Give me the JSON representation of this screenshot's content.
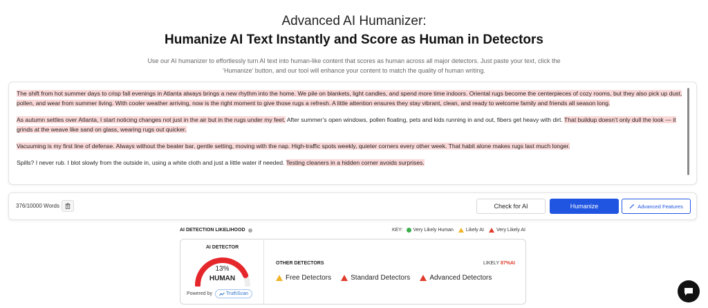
{
  "header": {
    "title_line1": "Advanced AI Humanizer:",
    "title_line2": "Humanize AI Text Instantly and Score as Human in Detectors",
    "subtitle": "Use our AI humanizer to effortlessly turn AI text into human-like content that scores as human across all major detectors. Just paste your text, click the ‘Humanize’ button, and our tool will enhance your content to match the quality of human writing."
  },
  "editor": {
    "paragraphs": [
      {
        "segments": [
          {
            "text": "The shift from hot summer days to crisp fall evenings in Atlanta always brings a new rhythm into the home. We pile on blankets, light candles, and spend more time indoors. Oriental rugs become the centerpieces of cozy rooms, but they also pick up dust, pollen, and wear from summer living. With cooler weather arriving, now is the right moment to give those rugs a refresh. A little attention ensures they stay vibrant, clean, and ready to welcome family and friends all season long.",
            "highlight": true
          }
        ]
      },
      {
        "segments": [
          {
            "text": "As autumn settles over Atlanta, I start noticing changes not just in the air but in the rugs under my feet.",
            "highlight": true
          },
          {
            "text": " After summer’s open windows, pollen floating, pets and kids running in and out, fibers get heavy with dirt. ",
            "highlight": false
          },
          {
            "text": "That buildup doesn’t only dull the look — it grinds at the weave like sand on glass, wearing rugs out quicker.",
            "highlight": true
          }
        ]
      },
      {
        "segments": [
          {
            "text": "Vacuuming is my first line of defense. Always without the beater bar, gentle setting, moving with the nap. High-traffic spots weekly, quieter corners every other week. That habit alone makes rugs last much longer.",
            "highlight": true
          }
        ]
      },
      {
        "segments": [
          {
            "text": "Spills? I never rub. I blot slowly from the outside in, using a white cloth and just a little water if needed. ",
            "highlight": false
          },
          {
            "text": "Testing cleaners in a hidden corner avoids surprises.",
            "highlight": true
          }
        ]
      }
    ]
  },
  "toolbar": {
    "word_count": "376/10000 Words",
    "check_label": "Check for AI",
    "humanize_label": "Humanize",
    "advanced_label": "Advanced Features"
  },
  "detection": {
    "title": "AI DETECTION LIKELIHOOD",
    "key_label": "KEY:",
    "key_very_likely_human": "Very Likely Human",
    "key_likely_ai": "Likely AI",
    "key_very_likely_ai": "Very Likely AI",
    "ai_detector_label": "AI DETECTOR",
    "human_percent": "13%",
    "human_fraction": 0.13,
    "human_label": "HUMAN",
    "powered_by": "Powered by",
    "truthscan": "TruthScan",
    "other_detectors_label": "OTHER DETECTORS",
    "likely_label": "LIKELY",
    "likely_value": "87%AI",
    "detectors": [
      {
        "name": "Free Detectors",
        "status": "likely-ai"
      },
      {
        "name": "Standard Detectors",
        "status": "very-likely-ai"
      },
      {
        "name": "Advanced Detectors",
        "status": "very-likely-ai"
      }
    ]
  },
  "colors": {
    "accent": "#1f55e0",
    "highlight": "#fbd8d8",
    "gauge_red": "#e5272b",
    "warning_yellow": "#f0b429",
    "danger_red": "#e03b2b",
    "good_green": "#3cae4c"
  }
}
